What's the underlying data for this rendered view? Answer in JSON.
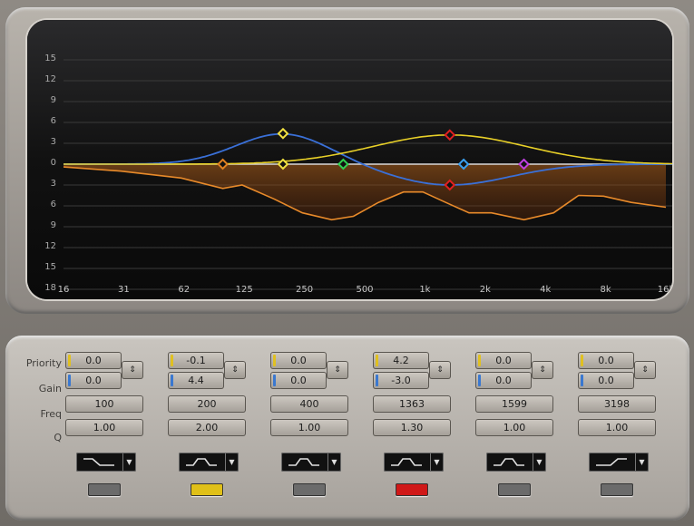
{
  "graph": {
    "y_labels": [
      "15",
      "12",
      "9",
      "6",
      "3",
      "0",
      "3",
      "6",
      "9",
      "12",
      "15",
      "18"
    ],
    "x_labels": [
      "16",
      "31",
      "62",
      "125",
      "250",
      "500",
      "1k",
      "2k",
      "4k",
      "8k",
      "16k"
    ]
  },
  "controls": {
    "row_labels": {
      "priority": "Priority",
      "gain": "Gain",
      "freq": "Freq",
      "q": "Q"
    },
    "bands": [
      {
        "priority": "0.0",
        "gain": "0.0",
        "freq": "100",
        "q": "1.00",
        "filter_icon": "low-shelf-icon",
        "led_color": "#6b6b6b",
        "priority_color": "#e0c020",
        "gain_color": "#3a78d0"
      },
      {
        "priority": "-0.1",
        "gain": "4.4",
        "freq": "200",
        "q": "2.00",
        "filter_icon": "bell-icon",
        "led_color": "#e0c018",
        "priority_color": "#e0c020",
        "gain_color": "#3a78d0"
      },
      {
        "priority": "0.0",
        "gain": "0.0",
        "freq": "400",
        "q": "1.00",
        "filter_icon": "bell-icon",
        "led_color": "#6b6b6b",
        "priority_color": "#e0c020",
        "gain_color": "#3a78d0"
      },
      {
        "priority": "4.2",
        "gain": "-3.0",
        "freq": "1363",
        "q": "1.30",
        "filter_icon": "bell-icon",
        "led_color": "#d01818",
        "priority_color": "#e0c020",
        "gain_color": "#3a78d0"
      },
      {
        "priority": "0.0",
        "gain": "0.0",
        "freq": "1599",
        "q": "1.00",
        "filter_icon": "bell-icon",
        "led_color": "#6b6b6b",
        "priority_color": "#e0c020",
        "gain_color": "#3a78d0"
      },
      {
        "priority": "0.0",
        "gain": "0.0",
        "freq": "3198",
        "q": "1.00",
        "filter_icon": "high-shelf-icon",
        "led_color": "#6b6b6b",
        "priority_color": "#e0c020",
        "gain_color": "#3a78d0"
      }
    ]
  },
  "nodes": [
    {
      "name": "band-1-node",
      "freq": 100,
      "gain": 0,
      "color": "#e08020"
    },
    {
      "name": "band-2-gain-node",
      "freq": 200,
      "gain": 4.4,
      "color": "#f0e040"
    },
    {
      "name": "band-2-priority-node",
      "freq": 200,
      "gain": 0,
      "color": "#f0e040"
    },
    {
      "name": "band-3-node",
      "freq": 400,
      "gain": 0,
      "color": "#30d050"
    },
    {
      "name": "band-4-priority-node",
      "freq": 1363,
      "gain": 4.2,
      "color": "#e02020"
    },
    {
      "name": "band-4-gain-node",
      "freq": 1363,
      "gain": -3.0,
      "color": "#e02020"
    },
    {
      "name": "band-5-node",
      "freq": 1599,
      "gain": 0,
      "color": "#3aa0f0"
    },
    {
      "name": "band-6-node",
      "freq": 3198,
      "gain": 0,
      "color": "#c040e0"
    }
  ],
  "colors": {
    "priority_curve": "#e8d028",
    "gain_curve": "#3a70d8",
    "spectrum": "#e88a2a",
    "zero_line": "#d8d8d8"
  }
}
